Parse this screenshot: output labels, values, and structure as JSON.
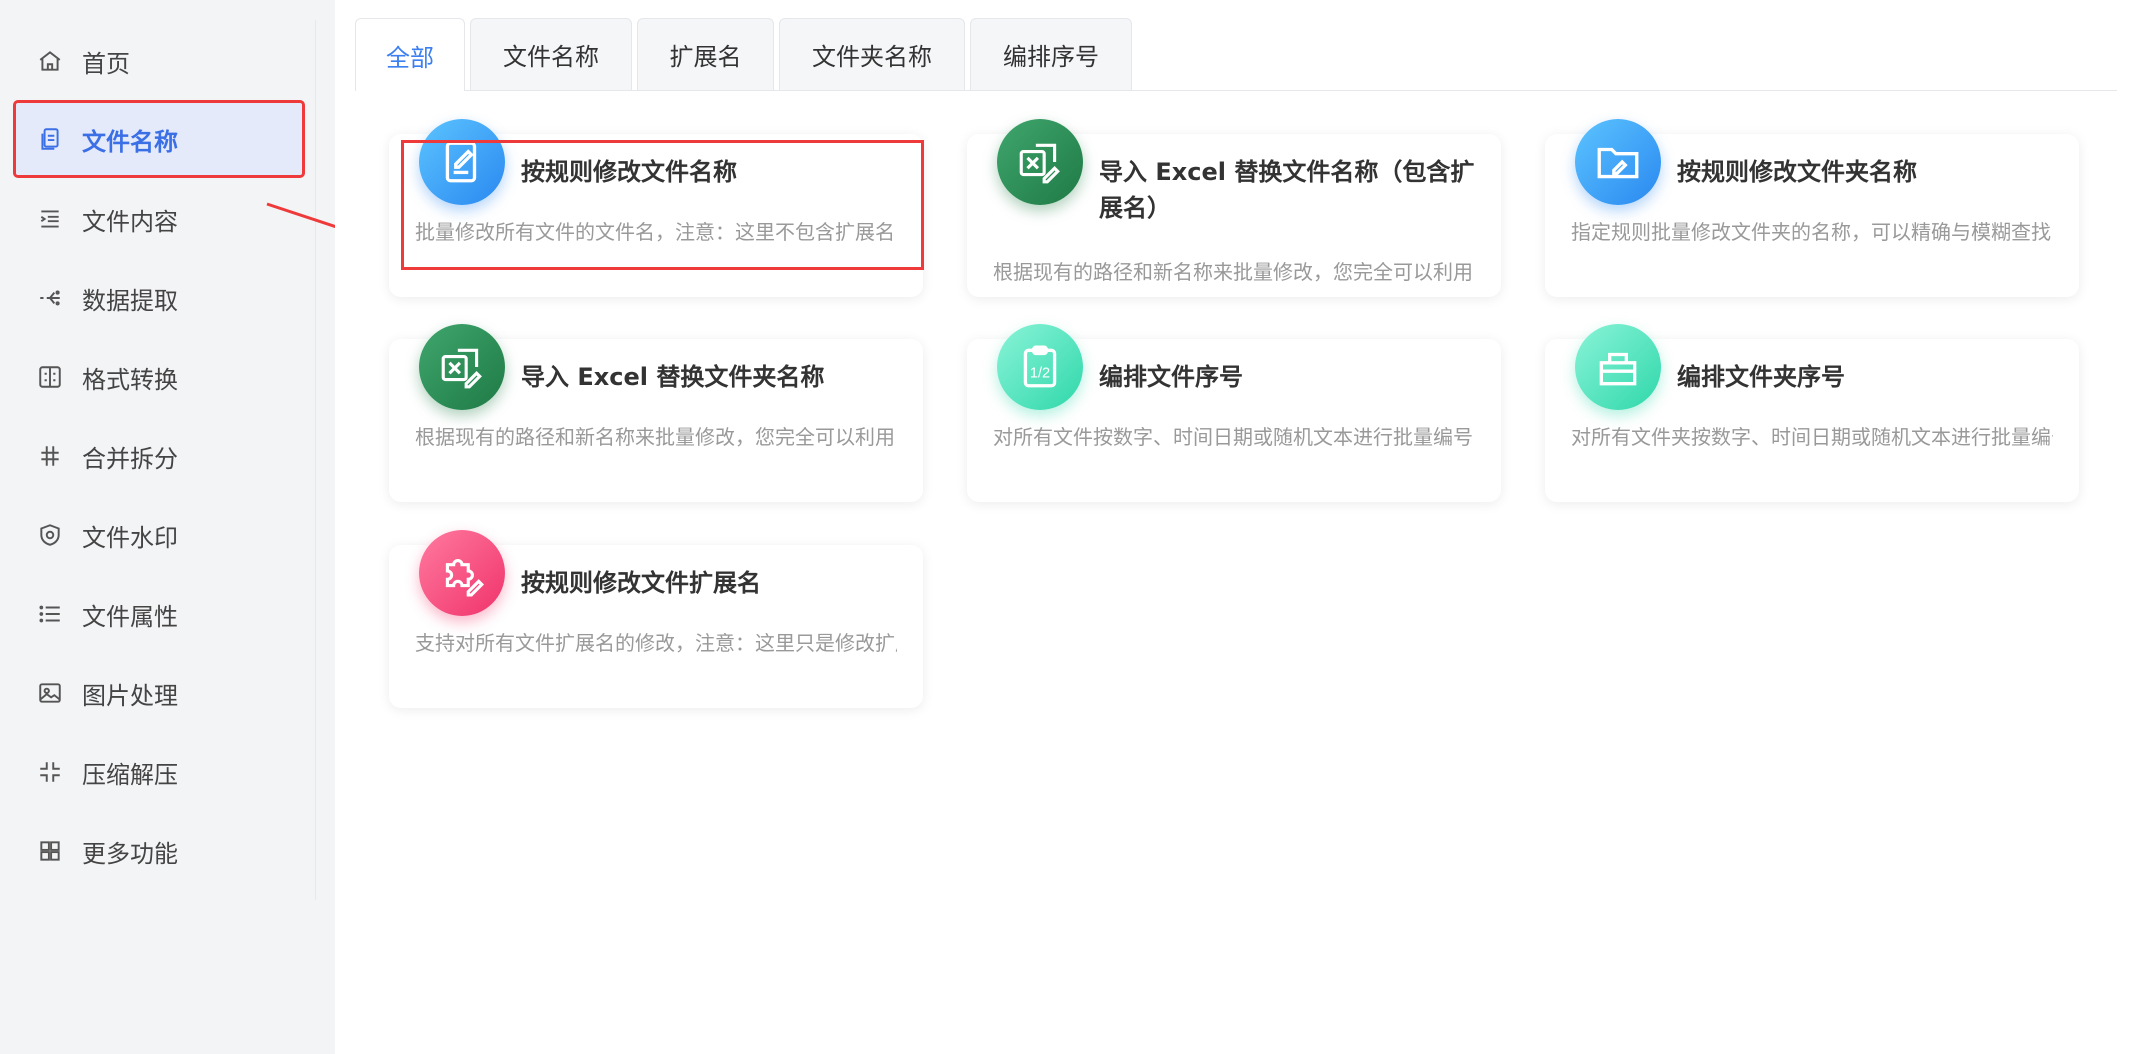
{
  "sidebar": {
    "items": [
      {
        "label": "首页",
        "icon": "home-icon"
      },
      {
        "label": "文件名称",
        "icon": "file-copy-icon",
        "active": true
      },
      {
        "label": "文件内容",
        "icon": "indent-list-icon"
      },
      {
        "label": "数据提取",
        "icon": "extract-icon"
      },
      {
        "label": "格式转换",
        "icon": "convert-icon"
      },
      {
        "label": "合并拆分",
        "icon": "hash-icon"
      },
      {
        "label": "文件水印",
        "icon": "shield-icon"
      },
      {
        "label": "文件属性",
        "icon": "list-icon"
      },
      {
        "label": "图片处理",
        "icon": "image-icon"
      },
      {
        "label": "压缩解压",
        "icon": "compress-icon"
      },
      {
        "label": "更多功能",
        "icon": "grid-icon"
      }
    ]
  },
  "tabs": [
    {
      "label": "全部",
      "active": true
    },
    {
      "label": "文件名称"
    },
    {
      "label": "扩展名"
    },
    {
      "label": "文件夹名称"
    },
    {
      "label": "编排序号"
    }
  ],
  "cards": [
    {
      "title": "按规则修改文件名称",
      "desc": "批量修改所有文件的文件名，注意：这里不包含扩展名",
      "icon": "edit-doc-icon",
      "color": "blue"
    },
    {
      "title": "导入 Excel 替换文件名称（包含扩展名）",
      "desc": "根据现有的路径和新名称来批量修改，您完全可以利用",
      "icon": "excel-edit-icon",
      "color": "green"
    },
    {
      "title": "按规则修改文件夹名称",
      "desc": "指定规则批量修改文件夹的名称，可以精确与模糊查找",
      "icon": "folder-edit-icon",
      "color": "blue"
    },
    {
      "title": "导入 Excel 替换文件夹名称",
      "desc": "根据现有的路径和新名称来批量修改，您完全可以利用",
      "icon": "excel-edit-icon",
      "color": "green"
    },
    {
      "title": "编排文件序号",
      "desc": "对所有文件按数字、时间日期或随机文本进行批量编号",
      "icon": "clipboard-number-icon",
      "color": "teal"
    },
    {
      "title": "编排文件夹序号",
      "desc": "对所有文件夹按数字、时间日期或随机文本进行批量编号",
      "icon": "folder-number-icon",
      "color": "teal"
    },
    {
      "title": "按规则修改文件扩展名",
      "desc": "支持对所有文件扩展名的修改，注意：这里只是修改扩展名",
      "icon": "puzzle-edit-icon",
      "color": "pink"
    }
  ],
  "colors": {
    "accent": "#3b7ff0",
    "highlight": "#ee3a3a"
  }
}
